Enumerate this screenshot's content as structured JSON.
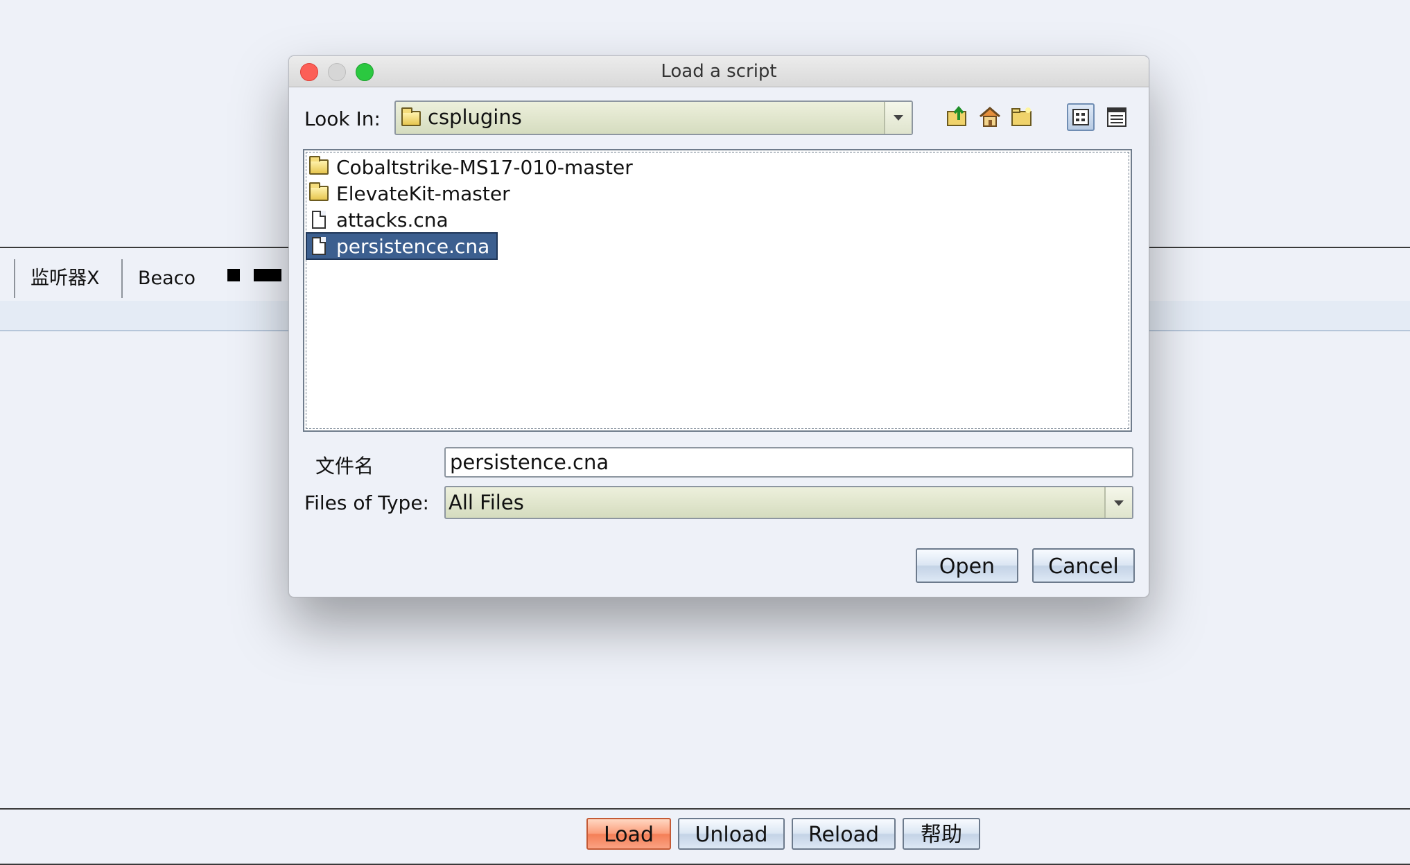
{
  "background_app": {
    "tabs": [
      {
        "label": "监听器X"
      },
      {
        "label": "Beaco"
      }
    ],
    "bottom_buttons": {
      "load": "Load",
      "unload": "Unload",
      "reload": "Reload",
      "help": "帮助"
    }
  },
  "dialog": {
    "title": "Load a script",
    "look_in_label": "Look In:",
    "look_in_value": "csplugins",
    "toolbar_icons": [
      "up-folder-icon",
      "home-icon",
      "new-folder-icon",
      "list-view-icon",
      "details-view-icon"
    ],
    "files": [
      {
        "name": "Cobaltstrike-MS17-010-master",
        "type": "folder",
        "selected": false
      },
      {
        "name": "ElevateKit-master",
        "type": "folder",
        "selected": false
      },
      {
        "name": "attacks.cna",
        "type": "file",
        "selected": false
      },
      {
        "name": "persistence.cna",
        "type": "file",
        "selected": true
      }
    ],
    "filename_label": "文件名",
    "filename_value": "persistence.cna",
    "filetype_label": "Files of Type:",
    "filetype_value": "All Files",
    "open_button": "Open",
    "cancel_button": "Cancel"
  },
  "colors": {
    "selection": "#3c5f8f",
    "load_button": "#f47f57"
  }
}
